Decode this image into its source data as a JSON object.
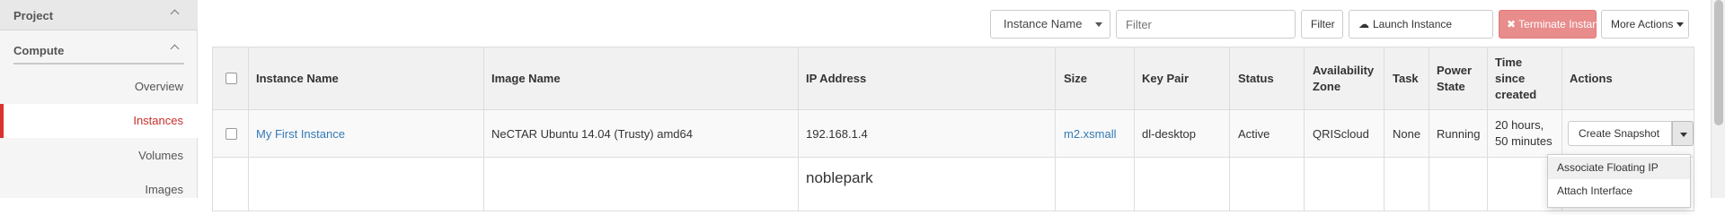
{
  "sidebar": {
    "project_label": "Project",
    "compute_label": "Compute",
    "items": [
      {
        "label": "Overview",
        "active": false
      },
      {
        "label": "Instances",
        "active": true
      },
      {
        "label": "Volumes",
        "active": false
      },
      {
        "label": "Images",
        "active": false
      }
    ]
  },
  "toolbar": {
    "filter_field_selected": "Instance Name",
    "filter_placeholder": "Filter",
    "filter_button": "Filter",
    "launch_button": "Launch Instance",
    "terminate_button": "Terminate Instances",
    "more_actions_button": "More Actions"
  },
  "table": {
    "headers": {
      "instance_name": "Instance Name",
      "image_name": "Image Name",
      "ip_address": "IP Address",
      "size": "Size",
      "key_pair": "Key Pair",
      "status": "Status",
      "availability_zone_1": "Availability",
      "availability_zone_2": "Zone",
      "task": "Task",
      "power_state_1": "Power",
      "power_state_2": "State",
      "time_1": "Time",
      "time_2": "since",
      "time_3": "created",
      "actions": "Actions"
    },
    "rows": [
      {
        "instance_name": "My First Instance",
        "image_name": "NeCTAR Ubuntu 14.04 (Trusty) amd64",
        "ip_address": "192.168.1.4",
        "size": "m2.xsmall",
        "key_pair": "dl-desktop",
        "status": "Active",
        "availability_zone": "QRIScloud",
        "task": "None",
        "power_state": "Running",
        "time_1": "20 hours,",
        "time_2": "50 minutes",
        "action": "Create Snapshot"
      },
      {
        "ip_address": "noblepark"
      }
    ]
  },
  "action_menu": {
    "items": [
      "Associate Floating IP",
      "Attach Interface"
    ]
  },
  "colors": {
    "link": "#337ab7",
    "active_nav": "#c9302c",
    "terminate_bg": "#e88c8c"
  }
}
